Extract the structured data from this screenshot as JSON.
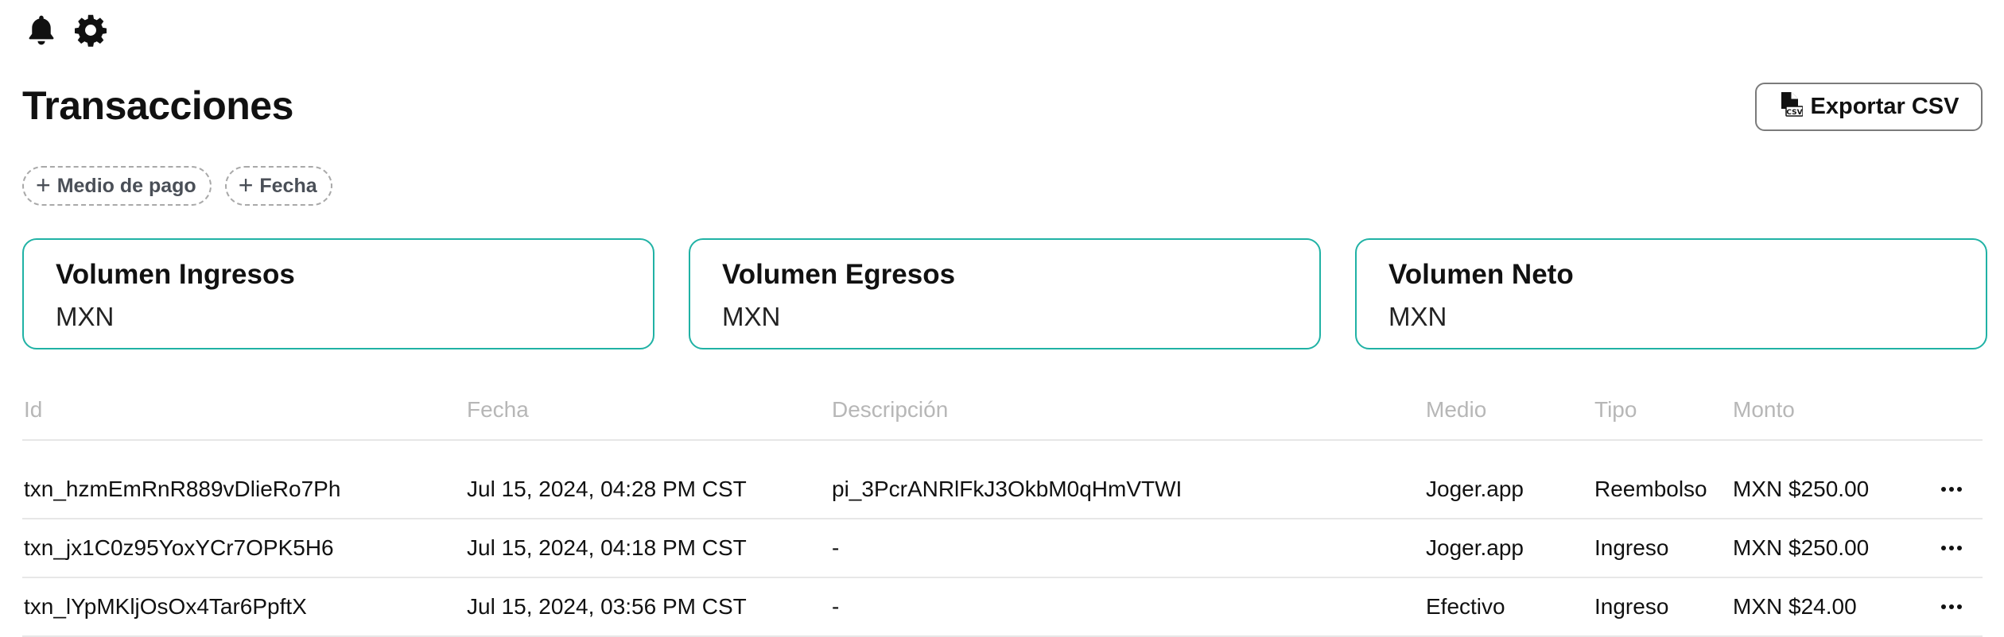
{
  "icons": {
    "notifications": "bell-icon",
    "settings": "gear-icon",
    "export": "csv-file-icon",
    "row_menu": "more-horizontal-icon"
  },
  "header": {
    "title": "Transacciones",
    "export_label": "Exportar CSV"
  },
  "filters": [
    {
      "label": "Medio de pago"
    },
    {
      "label": "Fecha"
    }
  ],
  "cards": [
    {
      "title": "Volumen Ingresos",
      "currency": "MXN"
    },
    {
      "title": "Volumen Egresos",
      "currency": "MXN"
    },
    {
      "title": "Volumen Neto",
      "currency": "MXN"
    }
  ],
  "table": {
    "headers": [
      "Id",
      "Fecha",
      "Descripción",
      "Medio",
      "Tipo",
      "Monto"
    ],
    "rows": [
      {
        "id": "txn_hzmEmRnR889vDlieRo7Ph",
        "fecha": "Jul 15, 2024, 04:28 PM CST",
        "descripcion": "pi_3PcrANRlFkJ3OkbM0qHmVTWI",
        "medio": "Joger.app",
        "tipo": "Reembolso",
        "monto": "MXN $250.00"
      },
      {
        "id": "txn_jx1C0z95YoxYCr7OPK5H6",
        "fecha": "Jul 15, 2024, 04:18 PM CST",
        "descripcion": "-",
        "medio": "Joger.app",
        "tipo": "Ingreso",
        "monto": "MXN $250.00"
      },
      {
        "id": "txn_lYpMKljOsOx4Tar6PpftX",
        "fecha": "Jul 15, 2024, 03:56 PM CST",
        "descripcion": "-",
        "medio": "Efectivo",
        "tipo": "Ingreso",
        "monto": "MXN $24.00"
      }
    ]
  },
  "colors": {
    "card_border": "#20b2a5",
    "header_text": "#b7b7b7",
    "divider": "#e7e7e7"
  }
}
